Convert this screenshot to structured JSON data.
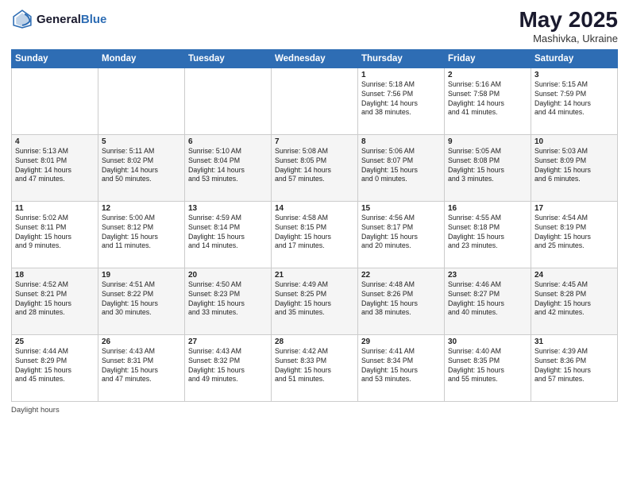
{
  "header": {
    "logo_line1": "General",
    "logo_line2": "Blue",
    "month": "May 2025",
    "location": "Mashivka, Ukraine"
  },
  "days_of_week": [
    "Sunday",
    "Monday",
    "Tuesday",
    "Wednesday",
    "Thursday",
    "Friday",
    "Saturday"
  ],
  "weeks": [
    [
      {
        "day": "",
        "content": ""
      },
      {
        "day": "",
        "content": ""
      },
      {
        "day": "",
        "content": ""
      },
      {
        "day": "",
        "content": ""
      },
      {
        "day": "1",
        "content": "Sunrise: 5:18 AM\nSunset: 7:56 PM\nDaylight: 14 hours\nand 38 minutes."
      },
      {
        "day": "2",
        "content": "Sunrise: 5:16 AM\nSunset: 7:58 PM\nDaylight: 14 hours\nand 41 minutes."
      },
      {
        "day": "3",
        "content": "Sunrise: 5:15 AM\nSunset: 7:59 PM\nDaylight: 14 hours\nand 44 minutes."
      }
    ],
    [
      {
        "day": "4",
        "content": "Sunrise: 5:13 AM\nSunset: 8:01 PM\nDaylight: 14 hours\nand 47 minutes."
      },
      {
        "day": "5",
        "content": "Sunrise: 5:11 AM\nSunset: 8:02 PM\nDaylight: 14 hours\nand 50 minutes."
      },
      {
        "day": "6",
        "content": "Sunrise: 5:10 AM\nSunset: 8:04 PM\nDaylight: 14 hours\nand 53 minutes."
      },
      {
        "day": "7",
        "content": "Sunrise: 5:08 AM\nSunset: 8:05 PM\nDaylight: 14 hours\nand 57 minutes."
      },
      {
        "day": "8",
        "content": "Sunrise: 5:06 AM\nSunset: 8:07 PM\nDaylight: 15 hours\nand 0 minutes."
      },
      {
        "day": "9",
        "content": "Sunrise: 5:05 AM\nSunset: 8:08 PM\nDaylight: 15 hours\nand 3 minutes."
      },
      {
        "day": "10",
        "content": "Sunrise: 5:03 AM\nSunset: 8:09 PM\nDaylight: 15 hours\nand 6 minutes."
      }
    ],
    [
      {
        "day": "11",
        "content": "Sunrise: 5:02 AM\nSunset: 8:11 PM\nDaylight: 15 hours\nand 9 minutes."
      },
      {
        "day": "12",
        "content": "Sunrise: 5:00 AM\nSunset: 8:12 PM\nDaylight: 15 hours\nand 11 minutes."
      },
      {
        "day": "13",
        "content": "Sunrise: 4:59 AM\nSunset: 8:14 PM\nDaylight: 15 hours\nand 14 minutes."
      },
      {
        "day": "14",
        "content": "Sunrise: 4:58 AM\nSunset: 8:15 PM\nDaylight: 15 hours\nand 17 minutes."
      },
      {
        "day": "15",
        "content": "Sunrise: 4:56 AM\nSunset: 8:17 PM\nDaylight: 15 hours\nand 20 minutes."
      },
      {
        "day": "16",
        "content": "Sunrise: 4:55 AM\nSunset: 8:18 PM\nDaylight: 15 hours\nand 23 minutes."
      },
      {
        "day": "17",
        "content": "Sunrise: 4:54 AM\nSunset: 8:19 PM\nDaylight: 15 hours\nand 25 minutes."
      }
    ],
    [
      {
        "day": "18",
        "content": "Sunrise: 4:52 AM\nSunset: 8:21 PM\nDaylight: 15 hours\nand 28 minutes."
      },
      {
        "day": "19",
        "content": "Sunrise: 4:51 AM\nSunset: 8:22 PM\nDaylight: 15 hours\nand 30 minutes."
      },
      {
        "day": "20",
        "content": "Sunrise: 4:50 AM\nSunset: 8:23 PM\nDaylight: 15 hours\nand 33 minutes."
      },
      {
        "day": "21",
        "content": "Sunrise: 4:49 AM\nSunset: 8:25 PM\nDaylight: 15 hours\nand 35 minutes."
      },
      {
        "day": "22",
        "content": "Sunrise: 4:48 AM\nSunset: 8:26 PM\nDaylight: 15 hours\nand 38 minutes."
      },
      {
        "day": "23",
        "content": "Sunrise: 4:46 AM\nSunset: 8:27 PM\nDaylight: 15 hours\nand 40 minutes."
      },
      {
        "day": "24",
        "content": "Sunrise: 4:45 AM\nSunset: 8:28 PM\nDaylight: 15 hours\nand 42 minutes."
      }
    ],
    [
      {
        "day": "25",
        "content": "Sunrise: 4:44 AM\nSunset: 8:29 PM\nDaylight: 15 hours\nand 45 minutes."
      },
      {
        "day": "26",
        "content": "Sunrise: 4:43 AM\nSunset: 8:31 PM\nDaylight: 15 hours\nand 47 minutes."
      },
      {
        "day": "27",
        "content": "Sunrise: 4:43 AM\nSunset: 8:32 PM\nDaylight: 15 hours\nand 49 minutes."
      },
      {
        "day": "28",
        "content": "Sunrise: 4:42 AM\nSunset: 8:33 PM\nDaylight: 15 hours\nand 51 minutes."
      },
      {
        "day": "29",
        "content": "Sunrise: 4:41 AM\nSunset: 8:34 PM\nDaylight: 15 hours\nand 53 minutes."
      },
      {
        "day": "30",
        "content": "Sunrise: 4:40 AM\nSunset: 8:35 PM\nDaylight: 15 hours\nand 55 minutes."
      },
      {
        "day": "31",
        "content": "Sunrise: 4:39 AM\nSunset: 8:36 PM\nDaylight: 15 hours\nand 57 minutes."
      }
    ]
  ],
  "footer": {
    "label": "Daylight hours"
  }
}
